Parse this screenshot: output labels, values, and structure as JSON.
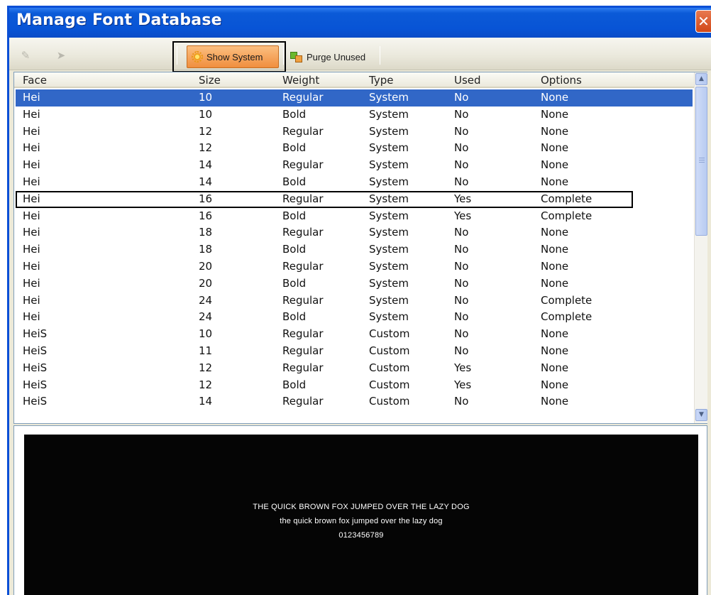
{
  "window": {
    "title": "Manage Font Database",
    "close_glyph": "✕"
  },
  "toolbar": {
    "edit_icon": "pencil-icon",
    "forward_icon": "arrow-icon",
    "show_system_label": "Show System",
    "show_system_icon": "sun-icon",
    "purge_unused_label": "Purge Unused",
    "purge_unused_icon": "purge-icon"
  },
  "list": {
    "columns": [
      "Face",
      "Size",
      "Weight",
      "Type",
      "Used",
      "Options"
    ],
    "rows": [
      {
        "face": "Hei",
        "size": "10",
        "weight": "Regular",
        "type": "System",
        "used": "No",
        "options": "None",
        "selected": true
      },
      {
        "face": "Hei",
        "size": "10",
        "weight": "Bold",
        "type": "System",
        "used": "No",
        "options": "None"
      },
      {
        "face": "Hei",
        "size": "12",
        "weight": "Regular",
        "type": "System",
        "used": "No",
        "options": "None"
      },
      {
        "face": "Hei",
        "size": "12",
        "weight": "Bold",
        "type": "System",
        "used": "No",
        "options": "None"
      },
      {
        "face": "Hei",
        "size": "14",
        "weight": "Regular",
        "type": "System",
        "used": "No",
        "options": "None"
      },
      {
        "face": "Hei",
        "size": "14",
        "weight": "Bold",
        "type": "System",
        "used": "No",
        "options": "None"
      },
      {
        "face": "Hei",
        "size": "16",
        "weight": "Regular",
        "type": "System",
        "used": "Yes",
        "options": "Complete",
        "outlined": true
      },
      {
        "face": "Hei",
        "size": "16",
        "weight": "Bold",
        "type": "System",
        "used": "Yes",
        "options": "Complete"
      },
      {
        "face": "Hei",
        "size": "18",
        "weight": "Regular",
        "type": "System",
        "used": "No",
        "options": "None"
      },
      {
        "face": "Hei",
        "size": "18",
        "weight": "Bold",
        "type": "System",
        "used": "No",
        "options": "None"
      },
      {
        "face": "Hei",
        "size": "20",
        "weight": "Regular",
        "type": "System",
        "used": "No",
        "options": "None"
      },
      {
        "face": "Hei",
        "size": "20",
        "weight": "Bold",
        "type": "System",
        "used": "No",
        "options": "None"
      },
      {
        "face": "Hei",
        "size": "24",
        "weight": "Regular",
        "type": "System",
        "used": "No",
        "options": "Complete"
      },
      {
        "face": "Hei",
        "size": "24",
        "weight": "Bold",
        "type": "System",
        "used": "No",
        "options": "Complete"
      },
      {
        "face": "HeiS",
        "size": "10",
        "weight": "Regular",
        "type": "Custom",
        "used": "No",
        "options": "None"
      },
      {
        "face": "HeiS",
        "size": "11",
        "weight": "Regular",
        "type": "Custom",
        "used": "No",
        "options": "None"
      },
      {
        "face": "HeiS",
        "size": "12",
        "weight": "Regular",
        "type": "Custom",
        "used": "Yes",
        "options": "None"
      },
      {
        "face": "HeiS",
        "size": "12",
        "weight": "Bold",
        "type": "Custom",
        "used": "Yes",
        "options": "None"
      },
      {
        "face": "HeiS",
        "size": "14",
        "weight": "Regular",
        "type": "Custom",
        "used": "No",
        "options": "None"
      }
    ]
  },
  "scrollbar": {
    "up_glyph": "▲",
    "down_glyph": "▼"
  },
  "preview": {
    "line1": "THE QUICK BROWN FOX JUMPED OVER THE LAZY DOG",
    "line2": "the quick brown fox jumped over the lazy dog",
    "line3": "0123456789"
  },
  "colors": {
    "titlebar": "#0854d6",
    "selection": "#3167c7",
    "active_button": "#f08e3e",
    "preview_background": "#050505"
  }
}
